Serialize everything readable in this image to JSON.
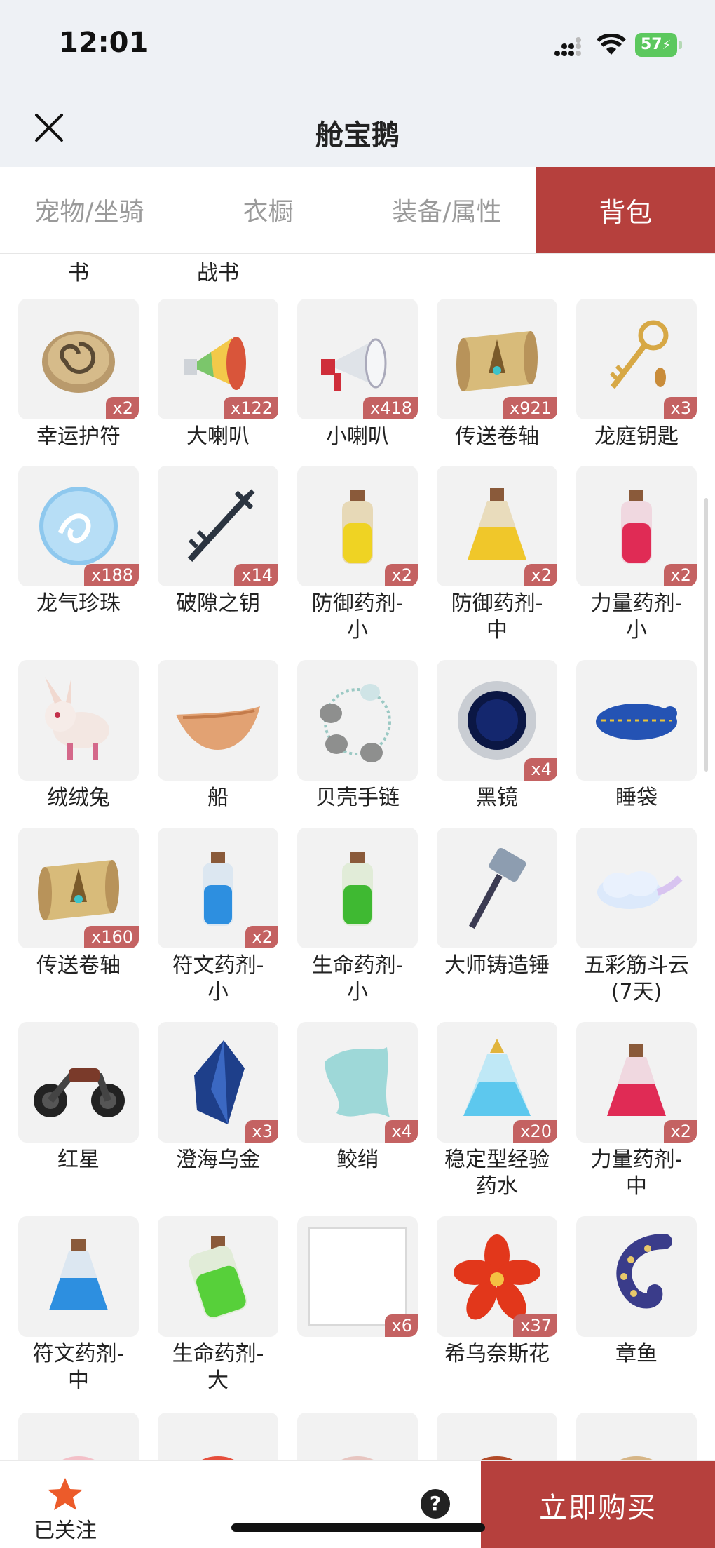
{
  "status": {
    "time": "12:01",
    "battery": "57"
  },
  "header": {
    "title": "舱宝鹅"
  },
  "tabs": [
    {
      "label": "宠物/坐骑",
      "active": false
    },
    {
      "label": "衣橱",
      "active": false
    },
    {
      "label": "装备/属性",
      "active": false
    },
    {
      "label": "背包",
      "active": true
    }
  ],
  "partial_row": [
    "书",
    "战书"
  ],
  "items": [
    {
      "label": "幸运护符",
      "count": "x2",
      "icon": "lucky-charm-icon"
    },
    {
      "label": "大喇叭",
      "count": "x122",
      "icon": "big-megaphone-icon"
    },
    {
      "label": "小喇叭",
      "count": "x418",
      "icon": "small-megaphone-icon"
    },
    {
      "label": "传送卷轴",
      "count": "x921",
      "icon": "teleport-scroll-icon"
    },
    {
      "label": "龙庭钥匙",
      "count": "x3",
      "icon": "dragon-key-icon"
    },
    {
      "label": "龙气珍珠",
      "count": "x188",
      "icon": "dragon-pearl-icon"
    },
    {
      "label": "破隙之钥",
      "count": "x14",
      "icon": "rift-key-icon"
    },
    {
      "label": "防御药剂-\n小",
      "count": "x2",
      "icon": "defense-potion-small-icon"
    },
    {
      "label": "防御药剂-\n中",
      "count": "x2",
      "icon": "defense-potion-medium-icon"
    },
    {
      "label": "力量药剂-\n小",
      "count": "x2",
      "icon": "strength-potion-small-icon"
    },
    {
      "label": "绒绒兔",
      "count": "",
      "icon": "fluffy-rabbit-icon"
    },
    {
      "label": "船",
      "count": "",
      "icon": "boat-icon"
    },
    {
      "label": "贝壳手链",
      "count": "",
      "icon": "shell-bracelet-icon"
    },
    {
      "label": "黑镜",
      "count": "x4",
      "icon": "black-mirror-icon"
    },
    {
      "label": "睡袋",
      "count": "",
      "icon": "sleeping-bag-icon"
    },
    {
      "label": "传送卷轴",
      "count": "x160",
      "icon": "teleport-scroll-icon"
    },
    {
      "label": "符文药剂-\n小",
      "count": "x2",
      "icon": "rune-potion-small-icon"
    },
    {
      "label": "生命药剂-\n小",
      "count": "",
      "icon": "life-potion-small-icon"
    },
    {
      "label": "大师铸造锤",
      "count": "",
      "icon": "master-hammer-icon"
    },
    {
      "label": "五彩筋斗云\n(7天)",
      "count": "",
      "icon": "rainbow-cloud-icon"
    },
    {
      "label": "红星",
      "count": "",
      "icon": "red-star-motorcycle-icon"
    },
    {
      "label": "澄海乌金",
      "count": "x3",
      "icon": "dark-crystal-icon"
    },
    {
      "label": "鲛绡",
      "count": "x4",
      "icon": "mermaid-silk-icon"
    },
    {
      "label": "稳定型经验\n药水",
      "count": "x20",
      "icon": "exp-potion-icon"
    },
    {
      "label": "力量药剂-\n中",
      "count": "x2",
      "icon": "strength-potion-medium-icon"
    },
    {
      "label": "符文药剂-\n中",
      "count": "",
      "icon": "rune-potion-medium-icon"
    },
    {
      "label": "生命药剂-\n大",
      "count": "",
      "icon": "life-potion-large-icon"
    },
    {
      "label": "",
      "count": "x6",
      "icon": "empty-frame-icon"
    },
    {
      "label": "希乌奈斯花",
      "count": "x37",
      "icon": "red-flower-icon"
    },
    {
      "label": "章鱼",
      "count": "",
      "icon": "octopus-tentacle-icon"
    }
  ],
  "bottom": {
    "follow_label": "已关注",
    "help_label": "?",
    "buy_label": "立即购买"
  },
  "colors": {
    "accent": "#b6403d",
    "badge": "#c46262",
    "header_bg": "#eef1f5"
  }
}
